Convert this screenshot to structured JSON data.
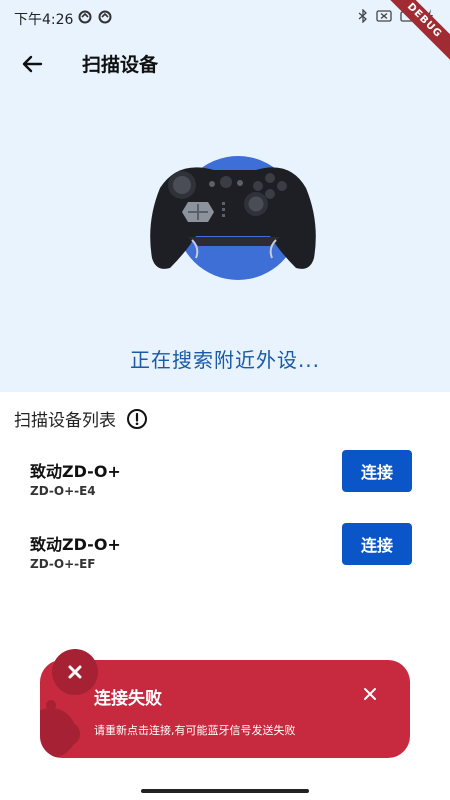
{
  "status_bar": {
    "time": "下午4:26",
    "debug": "DEBUG"
  },
  "header": {
    "title": "扫描设备"
  },
  "scan": {
    "status": "正在搜索附近外设..."
  },
  "list": {
    "title": "扫描设备列表",
    "devices": [
      {
        "name": "致动ZD-O+",
        "id": "ZD-O+-E4",
        "action": "连接"
      },
      {
        "name": "致动ZD-O+",
        "id": "ZD-O+-EF",
        "action": "连接"
      }
    ]
  },
  "toast": {
    "title": "连接失败",
    "message": "请重新点击连接,有可能蓝牙信号发送失败"
  },
  "colors": {
    "accent": "#0a55c7",
    "error": "#c72a3f",
    "top_bg": "#e8f3fd",
    "status_text": "#1a5aa6"
  }
}
